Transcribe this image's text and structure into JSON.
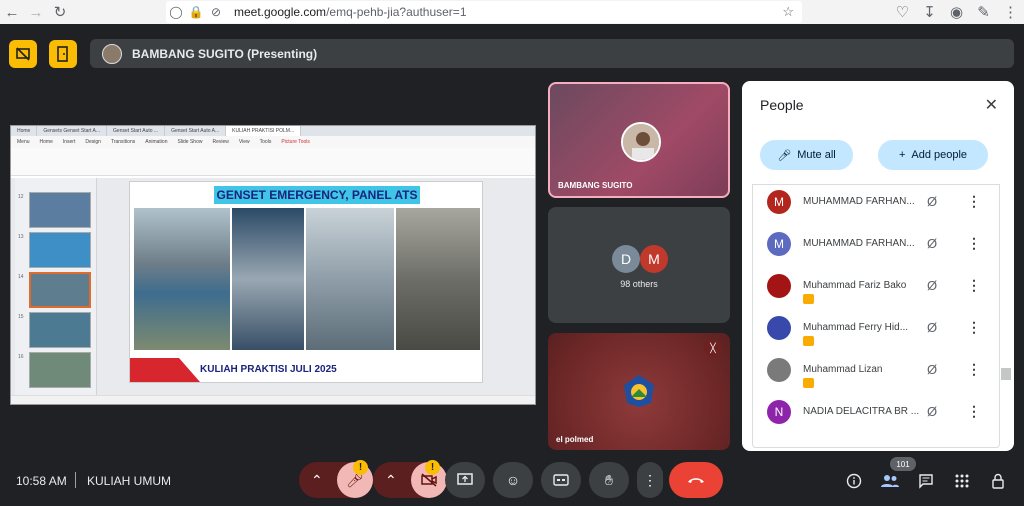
{
  "browser": {
    "url_domain": "meet.google.com",
    "url_path": "/emq-pehb-jia?authuser=1"
  },
  "presentation": {
    "presenter": "BAMBANG SUGITO (Presenting)"
  },
  "shared_screen": {
    "slide_title": "GENSET EMERGENCY, PANEL ATS",
    "slide_footer": "KULIAH PRAKTISI JULI 2025",
    "tabs": [
      "Gensets Genset Start A...",
      "Genset Start Auto ...",
      "Genset Start Auto A...",
      "KULIAH PRAKTISI POLM..."
    ]
  },
  "tiles": {
    "t1_name": "BAMBANG SUGITO",
    "t2_initial_a": "D",
    "t2_initial_b": "M",
    "t2_text": "98 others",
    "t3_name": "el polmed"
  },
  "people_panel": {
    "title": "People",
    "mute_all": "Mute all",
    "add_people": "Add people",
    "participants": [
      {
        "initial": "M",
        "name": "MUHAMMAD FARHAN...",
        "color": "#b3261e",
        "badge": false
      },
      {
        "initial": "M",
        "name": "MUHAMMAD FARHAN...",
        "color": "#5c6bc0",
        "badge": false
      },
      {
        "initial": "",
        "name": "Muhammad Fariz Bako",
        "color": "#a31515",
        "badge": true
      },
      {
        "initial": "",
        "name": "Muhammad Ferry Hid...",
        "color": "#3949ab",
        "badge": true
      },
      {
        "initial": "",
        "name": "Muhammad Lizan",
        "color": "#7a7a7a",
        "badge": true
      },
      {
        "initial": "N",
        "name": "NADIA DELACITRA BR ...",
        "color": "#8e24aa",
        "badge": false
      }
    ]
  },
  "bottom_bar": {
    "time": "10:58 AM",
    "meeting_name": "KULIAH UMUM",
    "participant_count": "101"
  },
  "colors": {
    "accent_yellow": "#fbbc04",
    "end_call_red": "#ea4335",
    "chip_blue": "#c2e7ff",
    "background": "#202124"
  }
}
